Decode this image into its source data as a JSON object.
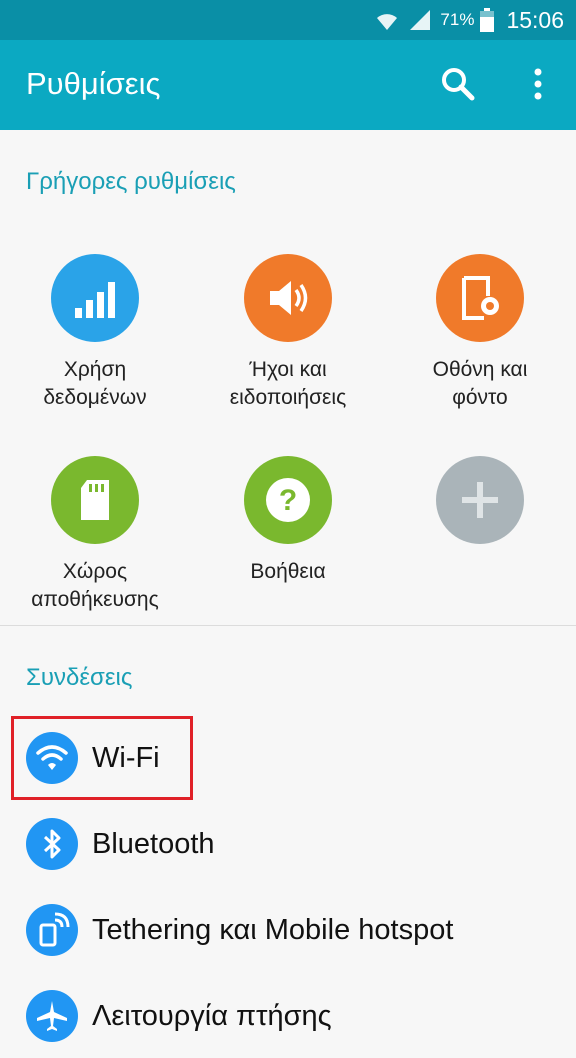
{
  "status_bar": {
    "battery_percent": "71%",
    "time": "15:06"
  },
  "app_bar": {
    "title": "Ρυθμίσεις"
  },
  "quick_settings": {
    "header": "Γρήγορες ρυθμίσεις",
    "items": [
      {
        "label_line1": "Χρήση",
        "label_line2": "δεδομένων",
        "icon": "data-usage-icon",
        "color": "#2aa3e8"
      },
      {
        "label_line1": "Ήχοι και",
        "label_line2": "ειδοποιήσεις",
        "icon": "volume-icon",
        "color": "#f07a2a"
      },
      {
        "label_line1": "Οθόνη και",
        "label_line2": "φόντο",
        "icon": "display-icon",
        "color": "#f07a2a"
      },
      {
        "label_line1": "Χώρος",
        "label_line2": "αποθήκευσης",
        "icon": "sd-card-icon",
        "color": "#7ab82e"
      },
      {
        "label_line1": "Βοήθεια",
        "label_line2": "",
        "icon": "help-icon",
        "color": "#7ab82e"
      },
      {
        "label_line1": "",
        "label_line2": "",
        "icon": "add-icon",
        "color": "#aab4b9"
      }
    ]
  },
  "connections": {
    "header": "Συνδέσεις",
    "items": [
      {
        "label": "Wi-Fi",
        "icon": "wifi-icon"
      },
      {
        "label": "Bluetooth",
        "icon": "bluetooth-icon"
      },
      {
        "label": "Tethering και Mobile hotspot",
        "icon": "hotspot-icon"
      },
      {
        "label": "Λειτουργία πτήσης",
        "icon": "airplane-icon"
      }
    ]
  },
  "colors": {
    "status_bar": "#0a8fa6",
    "app_bar": "#0ba9c2",
    "accent": "#1a9fb5",
    "list_icon": "#2196f3",
    "highlight": "#e02027"
  }
}
